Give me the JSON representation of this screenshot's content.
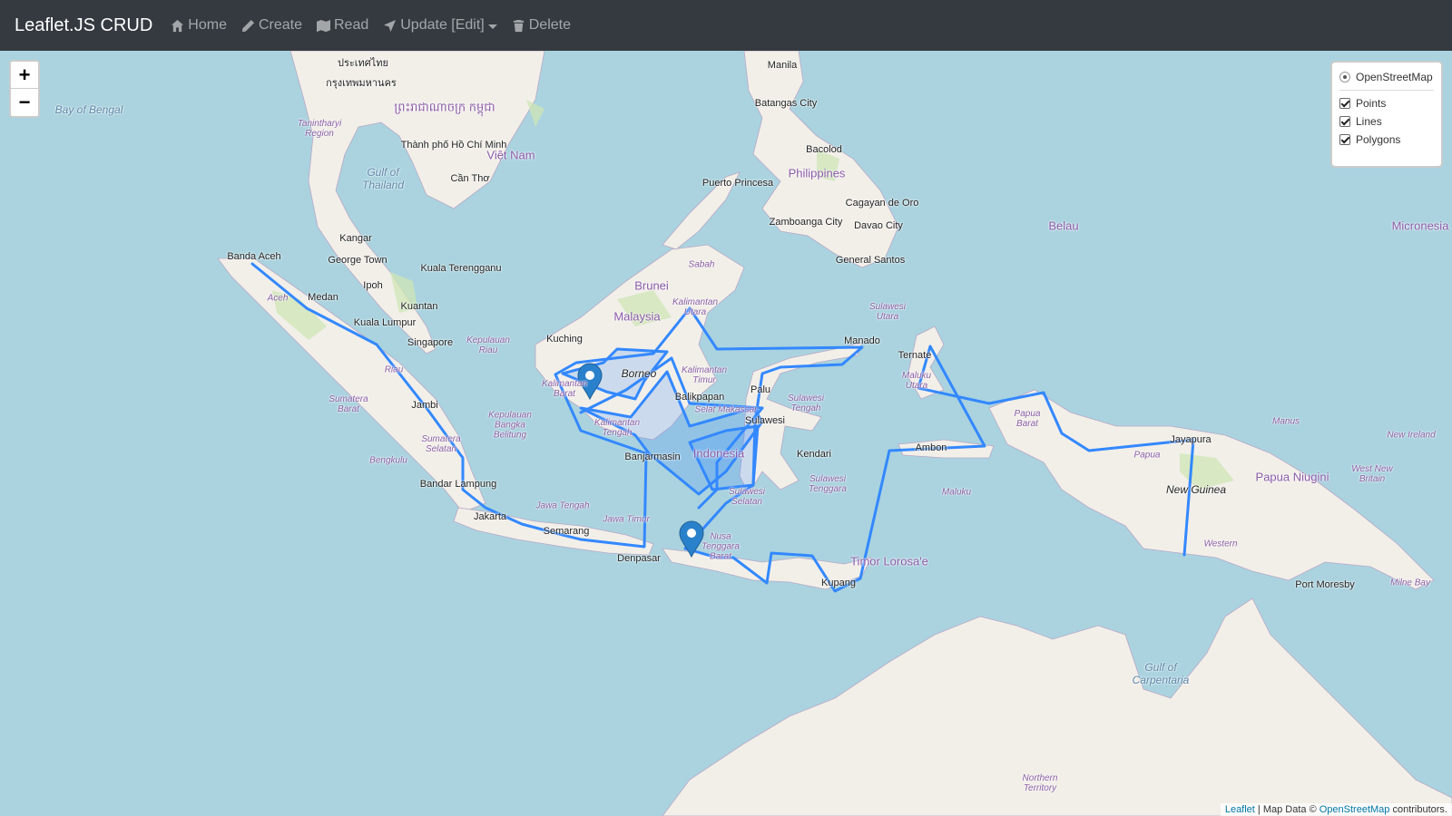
{
  "navbar": {
    "brand": "Leaflet.JS CRUD",
    "items": [
      {
        "label": "Home",
        "icon": "home-icon"
      },
      {
        "label": "Create",
        "icon": "pencil-icon"
      },
      {
        "label": "Read",
        "icon": "map-icon"
      },
      {
        "label": "Update [Edit]",
        "icon": "location-arrow-icon"
      },
      {
        "label": "Delete",
        "icon": "trash-icon"
      }
    ]
  },
  "zoom": {
    "in": "+",
    "out": "−"
  },
  "layers": {
    "base": "OpenStreetMap",
    "overlays": [
      "Points",
      "Lines",
      "Polygons"
    ]
  },
  "attribution": {
    "leaflet": "Leaflet",
    "sep": " | Map Data © ",
    "osm": "OpenStreetMap",
    "suffix": " contributors."
  },
  "labels": {
    "thailand": "ประเทศไทย",
    "bangkok": "กรุงเทพมหานคร",
    "cambodia": "ព្រះរាជាណាចក្រ កម្ពុជា",
    "hcmc": "Thành phố Hồ Chí Minh",
    "vietnam": "Việt Nam",
    "cantho": "Cần Thơ",
    "manila": "Manila",
    "batangas": "Batangas City",
    "bacolod": "Bacolod",
    "philippines": "Philippines",
    "puerto_princesa": "Puerto Princesa",
    "zamboanga": "Zamboanga City",
    "cagayan": "Cagayan de Oro",
    "davao": "Davao City",
    "gensan": "General Santos",
    "belau": "Belau",
    "micronesia": "Micronesia",
    "bay_bengal": "Bay of Bengal",
    "gulf_thailand": "Gulf of Thailand",
    "tanintharyi": "Tanintharyi Region",
    "banda_aceh": "Banda Aceh",
    "kangar": "Kangar",
    "georgetown": "George Town",
    "kuala_terengganu": "Kuala Terengganu",
    "ipoh": "Ipoh",
    "medan": "Medan",
    "kuantan": "Kuantan",
    "kuala_lumpur": "Kuala Lumpur",
    "singapore": "Singapore",
    "aceh": "Aceh",
    "riau": "Riau",
    "kep_riau": "Kepulauan Riau",
    "sumbar": "Sumatera Barat",
    "jambi": "Jambi",
    "sumsel": "Sumatera Selatan",
    "bangka": "Kepulauan Bangka Belitung",
    "bengkulu": "Bengkulu",
    "bandar_lampung": "Bandar Lampung",
    "jakarta": "Jakarta",
    "jateng": "Jawa Tengah",
    "semarang": "Semarang",
    "jatim": "Jawa Timur",
    "denpasar": "Denpasar",
    "ntb": "Nusa Tenggara Barat",
    "kupang": "Kupang",
    "timor": "Timor Lorosa'e",
    "brunei": "Brunei",
    "sabah": "Sabah",
    "malaysia": "Malaysia",
    "kuching": "Kuching",
    "kaltara": "Kalimantan Utara",
    "borneo": "Borneo",
    "kaltim": "Kalimantan Timur",
    "kalbar": "Kalimantan Barat",
    "kalteng": "Kalimantan Tengah",
    "balikpapan": "Balikpapan",
    "selat": "Selat Makassar",
    "banjarmasin": "Banjarmasin",
    "indonesia": "Indonesia",
    "palu": "Palu",
    "sulteng": "Sulawesi Tengah",
    "sulawesi": "Sulawesi",
    "sulsel": "Sulawesi Selatan",
    "kendari": "Kendari",
    "sultra": "Sulawesi Tenggara",
    "manado": "Manado",
    "sulut": "Sulawesi Utara",
    "ternate": "Ternate",
    "malut": "Maluku Utara",
    "ambon": "Ambon",
    "maluku": "Maluku",
    "papbar": "Papua Barat",
    "papua": "Papua",
    "jayapura": "Jayapura",
    "new_guinea": "New Guinea",
    "png": "Papua Niugini",
    "manus": "Manus",
    "new_ireland": "New Ireland",
    "new_britain": "West New Britain",
    "western": "Western",
    "port_moresby": "Port Moresby",
    "milne": "Milne Bay",
    "gulf_carp": "Gulf of Carpentaria",
    "nt": "Northern Territory"
  },
  "colors": {
    "water": "#aad3df",
    "land": "#f2efe9",
    "green": "#cde6b6",
    "feature": "#3388ff"
  }
}
